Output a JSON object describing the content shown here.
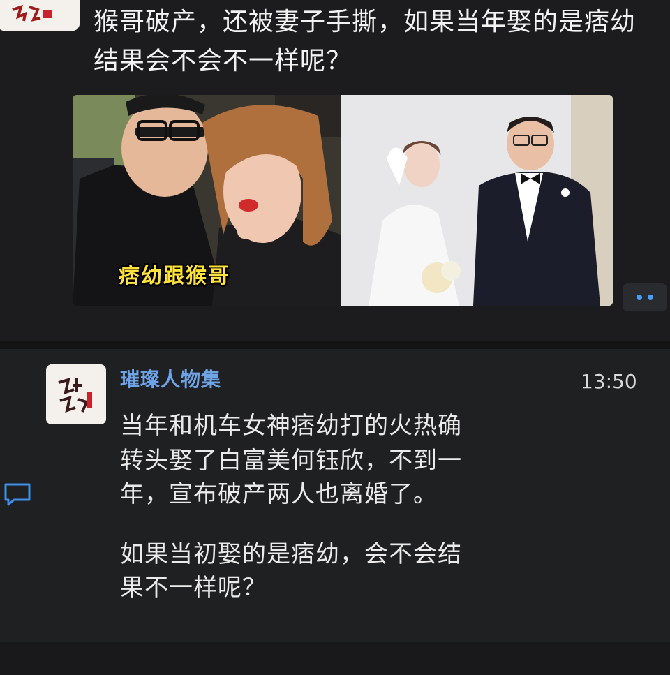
{
  "top_post": {
    "text": "猴哥破产，还被妻子手撕，如果当年娶的是痞幼结果会不会不一样呢？",
    "image_caption": "痞幼跟猴哥",
    "more_icon": "more-dots-icon",
    "accent": "#4a9dff"
  },
  "message": {
    "sender": "璀璨人物集",
    "time": "13:50",
    "lines": [
      "当年和机车女神痞幼打的火热确",
      "转头娶了白富美何钰欣，不到一",
      "年，宣布破产两人也离婚了。",
      "如果当初娶的是痞幼，会不会结",
      "果不一样呢？"
    ],
    "name_color": "#6fa3e8"
  },
  "side": {
    "comment_icon": "comment-icon",
    "icon_color": "#3f8fe8"
  }
}
